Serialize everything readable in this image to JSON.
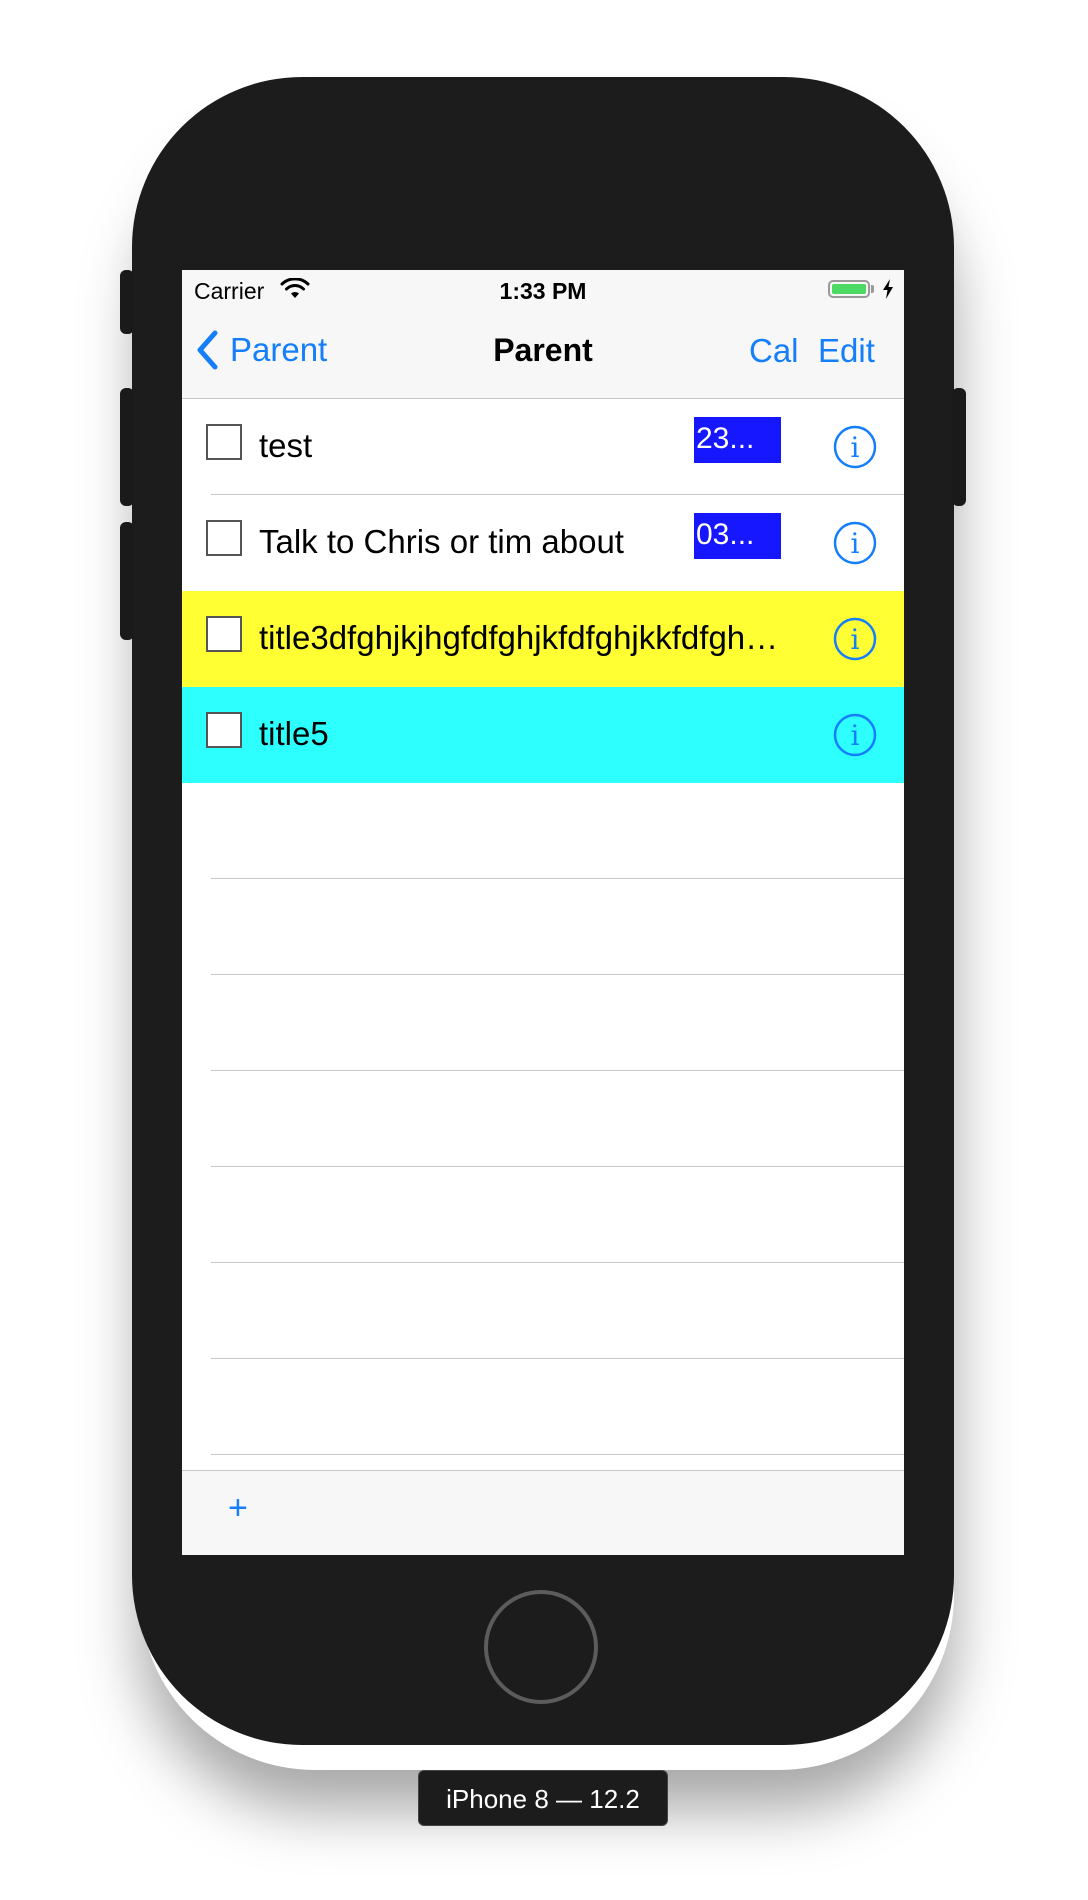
{
  "status_bar": {
    "carrier": "Carrier",
    "time": "1:33 PM"
  },
  "nav_bar": {
    "back_label": "Parent",
    "title": "Parent",
    "cal_label": "Cal",
    "edit_label": "Edit"
  },
  "rows": [
    {
      "title": "test",
      "date": "23...",
      "background": "#ffffff"
    },
    {
      "title": "Talk to Chris or tim about",
      "date": "03...",
      "background": "#ffffff"
    },
    {
      "title": "title3dfghjkjhgfdfghjkfdfghjkkfdfgh…",
      "background": "#ffff33"
    },
    {
      "title": "title5",
      "background": "#2dffff"
    }
  ],
  "empty_row_count": 7,
  "toolbar": {
    "add_label": "+"
  },
  "device_label": "iPhone 8 — 12.2",
  "colors": {
    "tint": "#147efb",
    "date_badge": "#1617ff"
  },
  "icons": {
    "back": "chevron-left-icon",
    "info": "info-circle-icon",
    "wifi": "wifi-icon",
    "battery": "battery-icon",
    "charging": "bolt-icon"
  }
}
